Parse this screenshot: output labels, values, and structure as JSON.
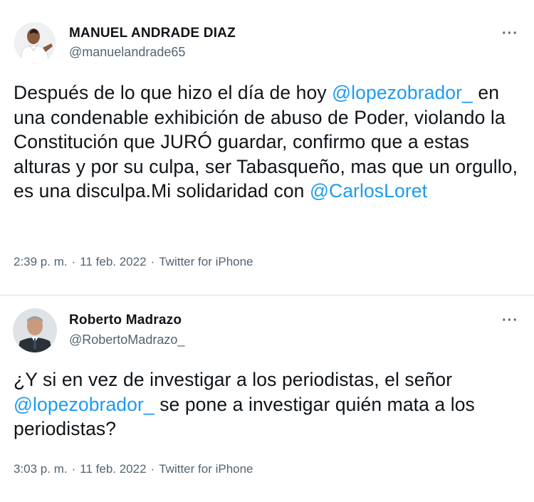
{
  "tweets": [
    {
      "name": "MANUEL ANDRADE DIAZ",
      "handle": "@manuelandrade65",
      "more_label": "···",
      "text_1": "Después de lo que hizo el día de hoy ",
      "mention_1": "@lopezobrador_",
      "text_2": " en una condenable exhibición de abuso de Poder, violando la Constitución que JURÓ guardar, confirmo que a  estas alturas y por su culpa, ser Tabasqueño, mas que un orgullo, es una disculpa.Mi solidaridad con ",
      "mention_2": "@CarlosLoret",
      "time": "2:39 p. m.",
      "date": "11 feb. 2022",
      "separator": "·",
      "source": "Twitter for iPhone"
    },
    {
      "name": "Roberto Madrazo",
      "handle": "@RobertoMadrazo_",
      "more_label": "···",
      "text_1": "¿Y si en vez de investigar a los periodistas, el señor ",
      "mention_1": "@lopezobrador_",
      "text_2": " se pone a investigar quién mata a los periodistas?",
      "time": "3:03 p. m.",
      "date": "11 feb. 2022",
      "separator": "·",
      "source": "Twitter for iPhone"
    }
  ],
  "colors": {
    "mention": "#1d9bf0",
    "secondary_text": "#536471",
    "primary_text": "#0f1419",
    "divider": "#eff3f4"
  },
  "icons": {
    "more": "more-options-icon",
    "avatar_1": "avatar-photo",
    "avatar_2": "avatar-photo"
  }
}
